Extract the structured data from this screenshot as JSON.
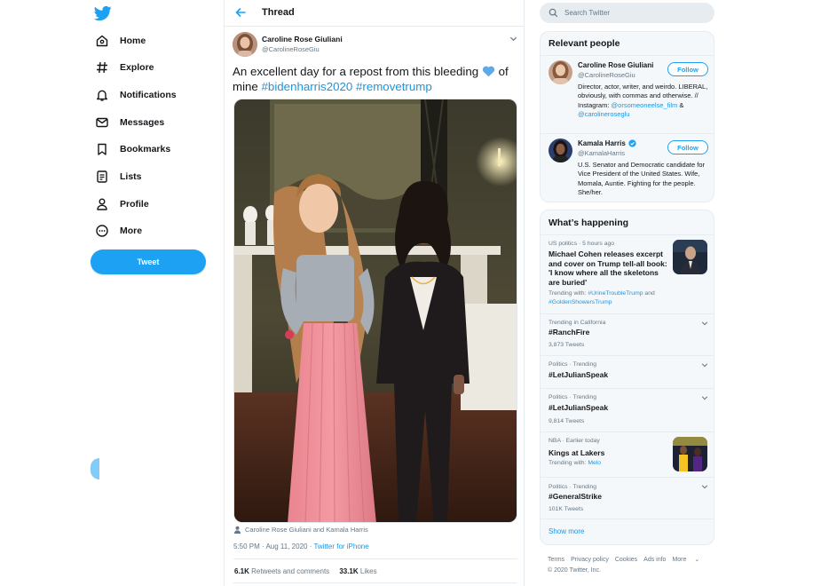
{
  "nav": {
    "items": [
      {
        "label": "Home",
        "icon": "home-icon"
      },
      {
        "label": "Explore",
        "icon": "hashtag-icon"
      },
      {
        "label": "Notifications",
        "icon": "bell-icon"
      },
      {
        "label": "Messages",
        "icon": "envelope-icon"
      },
      {
        "label": "Bookmarks",
        "icon": "bookmark-icon"
      },
      {
        "label": "Lists",
        "icon": "list-icon"
      },
      {
        "label": "Profile",
        "icon": "person-icon"
      },
      {
        "label": "More",
        "icon": "more-circle-icon"
      }
    ],
    "tweet_button": "Tweet"
  },
  "thread": {
    "title": "Thread",
    "author": {
      "name": "Caroline Rose Giuliani",
      "handle": "@CarolineRoseGiu"
    },
    "text_before": "An excellent day for a repost from this bleeding",
    "text_after": "of mine",
    "hashtags": [
      "#bidenharris2020",
      "#removetrump"
    ],
    "tagged": "Caroline Rose Giuliani and Kamala Harris",
    "timestamp": "5:50 PM · Aug 11, 2020 · ",
    "source": "Twitter for iPhone",
    "retweets_count": "6.1K",
    "retweets_label": "Retweets and comments",
    "likes_count": "33.1K",
    "likes_label": "Likes"
  },
  "search": {
    "placeholder": "Search Twitter"
  },
  "relevant": {
    "title": "Relevant people",
    "people": [
      {
        "name": "Caroline Rose Giuliani",
        "handle": "@CarolineRoseGiu",
        "bio": "Director, actor, writer, and weirdo. LIBERAL, obviously, with commas and otherwise. // Instagram:",
        "bio_link1": "@orsomeoneelse_film",
        "bio_amp": "&",
        "bio_link2": "@carolineroseglu",
        "follow": "Follow"
      },
      {
        "name": "Kamala Harris",
        "handle": "@KamalaHarris",
        "bio": "U.S. Senator and Democratic candidate for Vice President of the United States. Wife, Momala, Auntie. Fighting for the people. She/her.",
        "follow": "Follow"
      }
    ]
  },
  "happening": {
    "title": "What’s happening",
    "trends": [
      {
        "context": "US politics · 5 hours ago",
        "title": "Michael Cohen releases excerpt and cover on Trump tell-all book: 'I know where all the skeletons are buried'",
        "sub_prefix": "Trending with:",
        "sub_link1": "#UrineTroubleTrump",
        "sub_and": "and",
        "sub_link2": "#GoldenShowersTrump"
      },
      {
        "context": "Trending in California",
        "title": "#RanchFire",
        "sub": "3,873 Tweets"
      },
      {
        "context": "Politics · Trending",
        "title": "#LetJulianSpeak"
      },
      {
        "context": "Politics · Trending",
        "title": "#LetJulianSpeak",
        "sub": "9,814 Tweets"
      },
      {
        "context": "NBA · Earlier today",
        "title": "Kings at Lakers",
        "sub_prefix": "Trending with:",
        "sub_link1": "Melo"
      },
      {
        "context": "Politics · Trending",
        "title": "#GeneralStrike",
        "sub": "101K Tweets"
      }
    ],
    "show_more": "Show more"
  },
  "footer": {
    "links": [
      "Terms",
      "Privacy policy",
      "Cookies",
      "Ads info",
      "More"
    ],
    "copyright": "© 2020 Twitter, Inc."
  },
  "colors": {
    "accent": "#1da1f2",
    "link": "#1b95e0",
    "muted": "#657786",
    "heart": "#5da9e9"
  }
}
